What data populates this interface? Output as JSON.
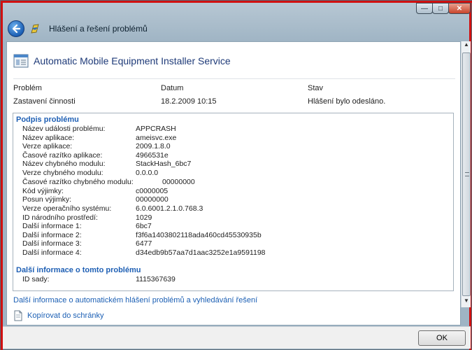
{
  "nav": {
    "title": "Hlášení a řešení problémů"
  },
  "window_buttons": {
    "minimize": "—",
    "maximize": "□",
    "close": "✕"
  },
  "header": {
    "title": "Automatic Mobile Equipment Installer Service"
  },
  "columns": {
    "headers": [
      "Problém",
      "Datum",
      "Stav"
    ],
    "values": [
      "Zastavení činnosti",
      "18.2.2009 10:15",
      "Hlášení bylo odesláno."
    ]
  },
  "signature": {
    "title": "Podpis problému",
    "rows": [
      {
        "label": "Název události problému:",
        "value": "APPCRASH"
      },
      {
        "label": "Název aplikace:",
        "value": "ameisvc.exe"
      },
      {
        "label": "Verze aplikace:",
        "value": "2009.1.8.0"
      },
      {
        "label": "Časové razítko aplikace:",
        "value": "4966531e"
      },
      {
        "label": "Název chybného modulu:",
        "value": "StackHash_6bc7"
      },
      {
        "label": "Verze chybného modulu:",
        "value": "0.0.0.0"
      },
      {
        "label": "Časové razítko chybného modulu:",
        "value": "00000000"
      },
      {
        "label": "Kód výjimky:",
        "value": "c0000005"
      },
      {
        "label": "Posun výjimky:",
        "value": "00000000"
      },
      {
        "label": "Verze operačního systému:",
        "value": "6.0.6001.2.1.0.768.3"
      },
      {
        "label": "ID národního prostředí:",
        "value": "1029"
      },
      {
        "label": "Další informace 1:",
        "value": "6bc7"
      },
      {
        "label": "Další informace 2:",
        "value": "f3f6a1403802118ada460cd45530935b"
      },
      {
        "label": "Další informace 3:",
        "value": "6477"
      },
      {
        "label": "Další informace 4:",
        "value": "d34edb9b57aa7d1aac3252e1a9591198"
      }
    ]
  },
  "more_info": {
    "title": "Další informace o tomto problému",
    "rows": [
      {
        "label": "ID sady:",
        "value": "1115367639"
      }
    ]
  },
  "links": {
    "more": "Další informace o automatickém hlášení problémů a vyhledávání řešení",
    "copy": "Kopírovat do schránky"
  },
  "ok_label": "OK",
  "icons": [
    "back-arrow-icon",
    "action-center-icon",
    "report-icon",
    "copy-icon"
  ],
  "colors": {
    "link": "#1b5fb4",
    "section_title": "#1e5fb4",
    "frame_alert": "#d01010"
  }
}
